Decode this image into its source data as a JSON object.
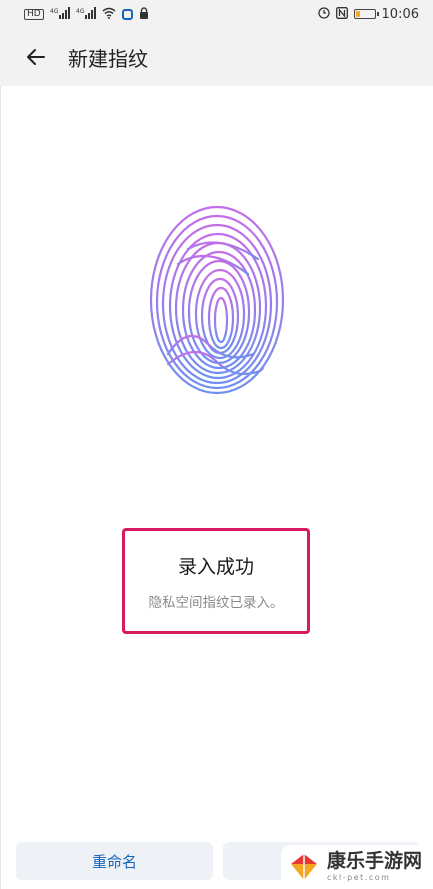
{
  "status_bar": {
    "left_icons": [
      "hd-icon",
      "signal-4g-icon",
      "signal-4g-icon",
      "wifi-icon",
      "shield-app-icon",
      "lock-icon"
    ],
    "left_labels": {
      "hd": "HD",
      "net1": "4G",
      "net2": "4G"
    },
    "right_icons": [
      "alarm-icon",
      "nfc-icon",
      "battery-icon"
    ],
    "battery_level": 0.2,
    "time": "10:06"
  },
  "app_bar": {
    "title": "新建指纹"
  },
  "result": {
    "title": "录入成功",
    "subtitle": "隐私空间指纹已录入。"
  },
  "buttons": {
    "rename_label": "重命名"
  },
  "watermark": {
    "main": "康乐手游网",
    "sub": "ckl-pet.com"
  },
  "colors": {
    "accent": "#1565c0",
    "highlight_border": "#d81b60",
    "fingerprint_top": "#c36ee8",
    "fingerprint_bottom": "#6f8ff0",
    "battery": "#f5a623"
  }
}
